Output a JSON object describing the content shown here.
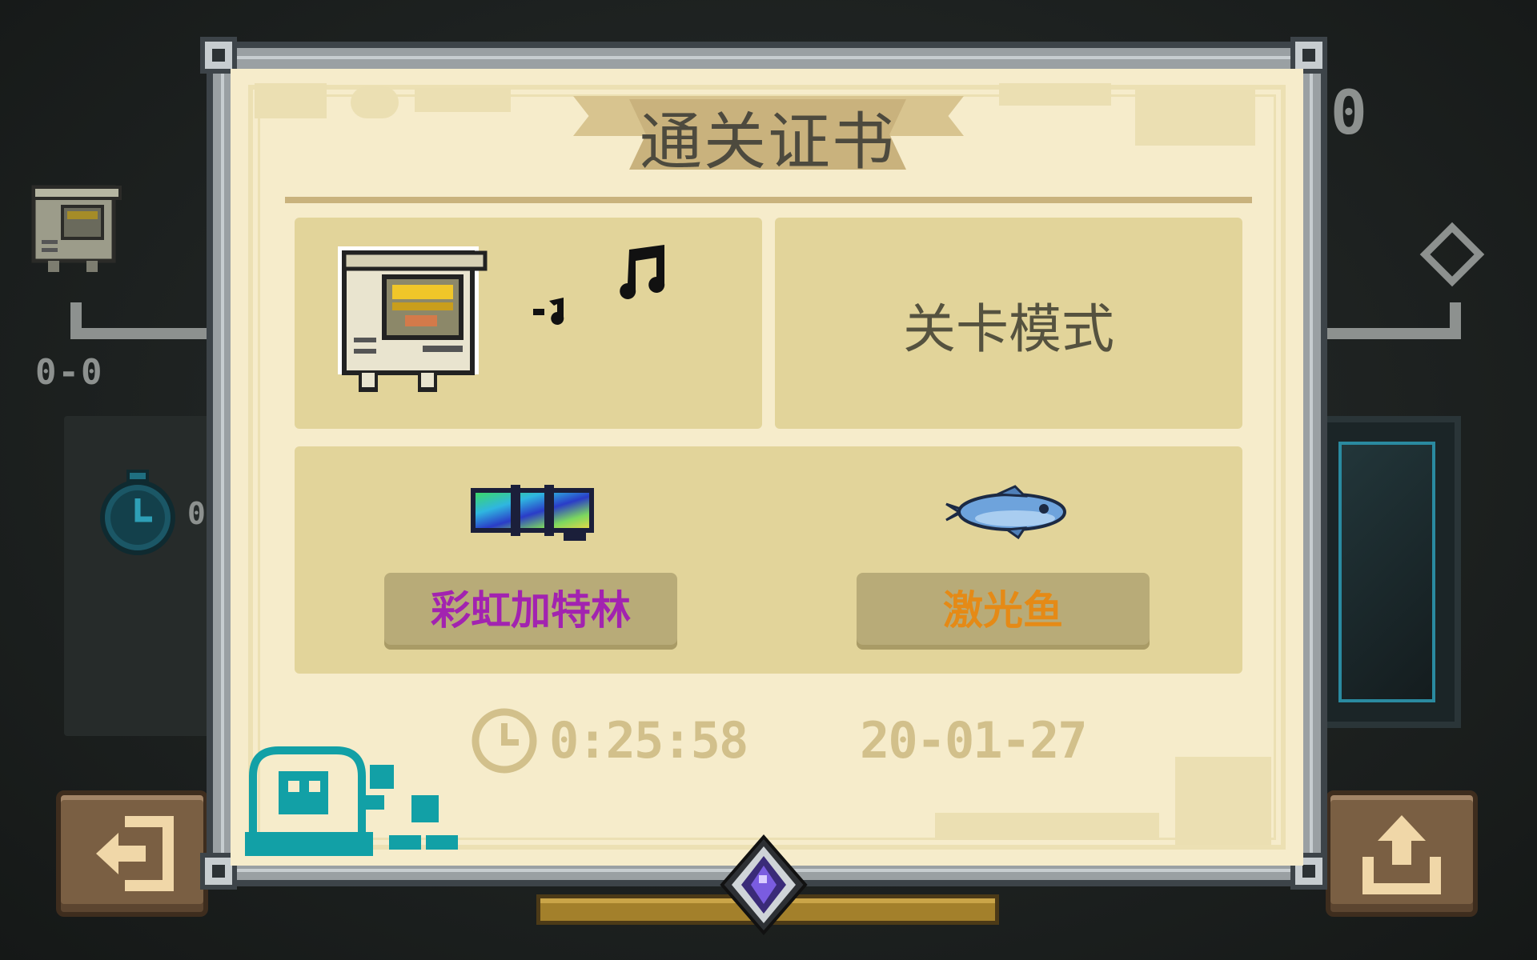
{
  "certificate": {
    "title": "通关证书",
    "mode": "关卡模式",
    "items": [
      {
        "name": "彩虹加特林",
        "color": "#a223b0",
        "icon": "rainbow-gatling-icon"
      },
      {
        "name": "激光鱼",
        "color": "#e58a16",
        "icon": "laser-fish-icon"
      }
    ],
    "time": "0:25:58",
    "date": "20-01-27",
    "character_icon": "robot-computer-character-icon",
    "music_icon": "music-notes-icon"
  },
  "background_hud": {
    "score": "0-0",
    "stopwatch_value": "0",
    "count": "0",
    "exit_button_icon": "exit-door-icon",
    "share_button_icon": "share-upload-icon"
  }
}
